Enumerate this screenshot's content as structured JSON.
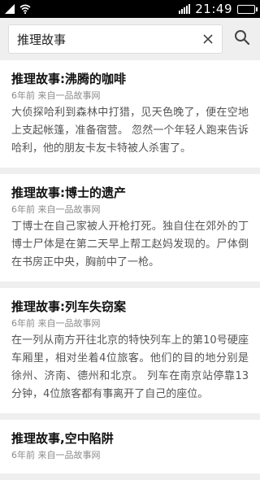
{
  "status_bar": {
    "time": "21:49",
    "icons": [
      "signal-icon",
      "wifi-icon",
      "signal-bars-icon",
      "battery-icon"
    ]
  },
  "search": {
    "query": "推理故事",
    "clear_icon": "close-icon",
    "submit_icon": "search-icon"
  },
  "results": [
    {
      "title": "推理故事:沸腾的咖啡",
      "meta": "6年前 来自一品故事网",
      "excerpt": "大侦探哈利到森林中打猎，见天色晚了，便在空地上支起帐篷，准备宿营。 忽然一个年轻人跑来告诉哈利，他的朋友卡友卡特被人杀害了。"
    },
    {
      "title": "推理故事:博士的遗产",
      "meta": "6年前 来自一品故事网",
      "excerpt": "丁博士在自己家被人开枪打死。独自住在郊外的丁博士尸体是在第二天早上帮工赵妈发现的。尸体倒在书房正中央，胸前中了一枪。"
    },
    {
      "title": "推理故事:列车失窃案",
      "meta": "6年前 来自一品故事网",
      "excerpt": "在一列从南方开往北京的特快列车上的第10号硬座车厢里，相对坐着4位旅客。他们的目的地分别是徐州、济南、德州和北京。 列车在南京站停靠13分钟，4位旅客都有事离开了自己的座位。"
    },
    {
      "title": "推理故事,空中陷阱",
      "meta": "6年前 来自一品故事网",
      "excerpt": ""
    }
  ]
}
